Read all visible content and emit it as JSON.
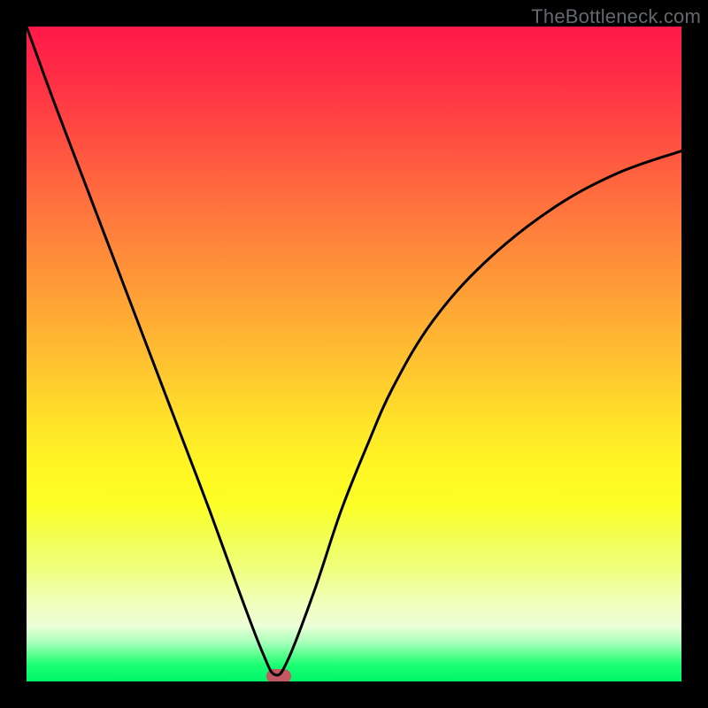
{
  "watermark": "TheBottleneck.com",
  "colors": {
    "frame_border": "#000000",
    "curve_stroke": "#000000",
    "marker_fill": "#c25861",
    "gradient_top": "#ff1949",
    "gradient_bottom": "#00f56b"
  },
  "chart_data": {
    "type": "line",
    "title": "",
    "xlabel": "",
    "ylabel": "",
    "xlim": [
      0,
      100
    ],
    "ylim": [
      0,
      100
    ],
    "legend": false,
    "grid": false,
    "notes": "V-shaped bottleneck curve over vertical heatmap gradient (red=high bottleneck at top, green=low at bottom). Minimum near x≈38.",
    "marker": {
      "x": 38.5,
      "y": 0.8,
      "shape": "rounded-pill",
      "color": "#c25861"
    },
    "series": [
      {
        "name": "bottleneck-curve",
        "x": [
          0,
          4,
          8,
          12,
          16,
          20,
          24,
          28,
          32,
          36,
          38,
          40,
          44,
          48,
          52,
          56,
          62,
          70,
          80,
          90,
          100
        ],
        "y": [
          100,
          89,
          78.5,
          68,
          57.5,
          47,
          36.5,
          26,
          15,
          4.5,
          1,
          3.5,
          14,
          26,
          36,
          45,
          55,
          64,
          72,
          77.5,
          81
        ]
      }
    ]
  }
}
